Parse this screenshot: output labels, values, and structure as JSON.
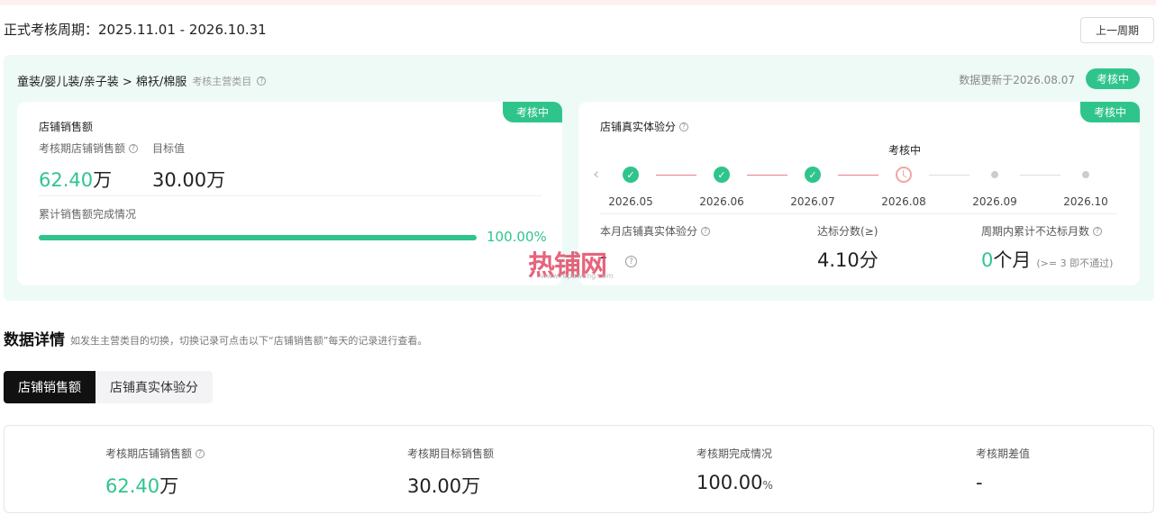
{
  "period": {
    "label": "正式考核周期：2025.11.01 - 2026.10.31",
    "prev_button": "上一周期"
  },
  "panel": {
    "breadcrumb": "童装/婴儿装/亲子装 > 棉袄/棉服",
    "breadcrumb_sub": "考核主营类目",
    "updated": "数据更新于2026.08.07",
    "status": "考核中"
  },
  "sales_card": {
    "tag": "考核中",
    "title": "店铺销售额",
    "current_label": "考核期店铺销售额",
    "current_value": "62.40",
    "current_unit": "万",
    "target_label": "目标值",
    "target_value": "30.00",
    "target_unit": "万",
    "progress_label": "累计销售额完成情况",
    "progress_fraction": 1.0,
    "progress_text": "100.00%"
  },
  "score_card": {
    "tag": "考核中",
    "title": "店铺真实体验分",
    "timeline_current": "考核中",
    "months": [
      "2026.05",
      "2026.06",
      "2026.07",
      "2026.08",
      "2026.09",
      "2026.10"
    ],
    "month_states": [
      "done",
      "done",
      "done",
      "current",
      "future",
      "future"
    ],
    "stat1_label": "本月店铺真实体验分",
    "stat1_value": "-",
    "stat2_label": "达标分数(≥)",
    "stat2_value": "4.10分",
    "stat3_label": "周期内累计不达标月数",
    "stat3_value_num": "0",
    "stat3_value_unit": "个月",
    "stat3_note": "(>= 3 即不通过)"
  },
  "watermark": {
    "text": "热铺网",
    "url": "www.repuwang.com"
  },
  "details": {
    "title": "数据详情",
    "desc": "如发生主营类目的切换，切换记录可点击以下“店铺销售额”每天的记录进行查看。",
    "tab_active": "店铺销售额",
    "tab_inactive": "店铺真实体验分",
    "col1_label": "考核期店铺销售额",
    "col1_value": "62.40",
    "col1_unit": "万",
    "col2_label": "考核期目标销售额",
    "col2_value": "30.00万",
    "col3_label": "考核期完成情况",
    "col3_value": "100.00",
    "col3_unit": "%",
    "col4_label": "考核期差值",
    "col4_value": "-"
  },
  "colors": {
    "accent": "#30c48d",
    "panel_bg": "#eefaf5",
    "timeline_red": "#e87d8a"
  }
}
